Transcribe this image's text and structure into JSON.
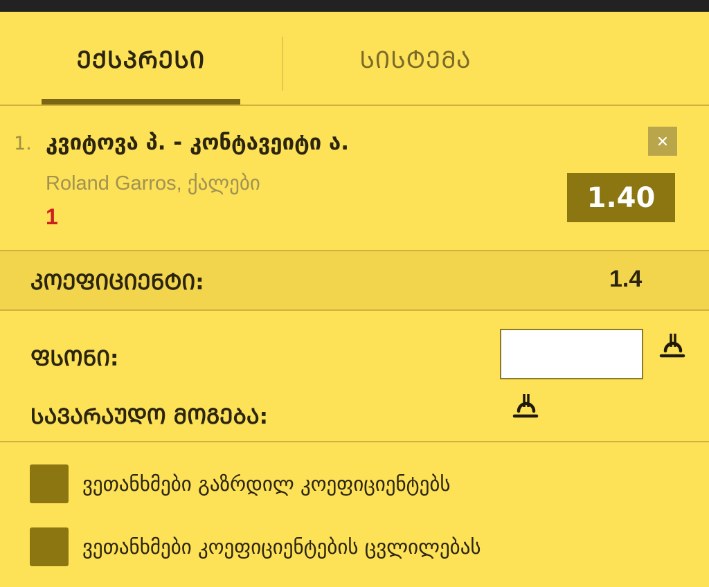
{
  "tabs": [
    {
      "label": "ᲔᲥᲡᲞᲠᲔᲡᲘ",
      "active": true
    },
    {
      "label": "ᲡᲘᲡᲢᲔᲛᲐ",
      "active": false
    }
  ],
  "bet": {
    "index": "1.",
    "title": "კვიტოვა პ. - კონტავეიტი ა.",
    "tournament": "Roland Garros, ქალები",
    "pick": "1",
    "odds": "1.40",
    "close_icon": "close-icon"
  },
  "summary": {
    "coef_label": "ᲙᲝᲔᲤᲘᲪᲘᲔᲜᲢᲘ:",
    "coef_value": "1.4",
    "stake_label": "ᲤᲡᲝᲜᲘ:",
    "stake_value": "",
    "currency_icon": "lari-icon",
    "winnings_label": "ᲡᲐᲕᲐᲠᲐᲣᲓᲝ ᲛᲝᲒᲔᲑᲐ:"
  },
  "options": [
    {
      "label": "ვეთანხმები გაზრდილ კოეფიციენტებს",
      "checked": false
    },
    {
      "label": "ვეთანხმები კოეფიციენტების ცვლილებას",
      "checked": false
    }
  ],
  "colors": {
    "background": "#fde157",
    "accent": "#8b7611",
    "pick": "#cc1f1f"
  }
}
